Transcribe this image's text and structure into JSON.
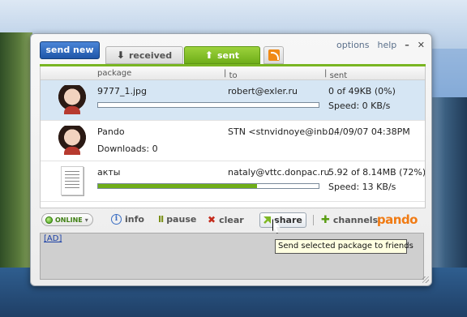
{
  "window": {
    "send_new_label": "send new",
    "menu": {
      "options": "options",
      "help": "help",
      "minimize": "–",
      "close": "✕"
    }
  },
  "tabs": {
    "received": {
      "label": "received",
      "icon": "download-arrow-icon"
    },
    "sent": {
      "label": "sent",
      "icon": "upload-arrow-icon"
    },
    "rss": {
      "icon": "rss-icon"
    }
  },
  "list": {
    "columns": [
      "package",
      "to",
      "sent"
    ],
    "rows": [
      {
        "package": "9777_1.jpg",
        "to": "robert@exler.ru",
        "sent": "0 of 49KB (0%)",
        "detail": "Speed: 0 KB/s",
        "progress": 0,
        "thumb": "photo-portrait"
      },
      {
        "package": "Pando",
        "to": "STN <stnvidnoye@inb…",
        "sent": "04/09/07 04:38PM",
        "detail": "Downloads: 0",
        "thumb": "photo-portrait"
      },
      {
        "package": "акты",
        "to": "nataly@vttc.donpac.ru",
        "sent": "5.92 of 8.14MB (72%)",
        "detail": "Speed: 13 KB/s",
        "progress": 72,
        "thumb": "document"
      }
    ]
  },
  "toolbar": {
    "online": "ONLINE",
    "info": "info",
    "pause": "pause",
    "clear": "clear",
    "share": "share",
    "channels": "channels",
    "logo": "pando"
  },
  "ad": {
    "label": "[AD]"
  },
  "tooltip": "Send selected package to friends",
  "colors": {
    "accent_green": "#79b522",
    "brand_orange": "#f07b14",
    "send_blue": "#1f56a8"
  }
}
